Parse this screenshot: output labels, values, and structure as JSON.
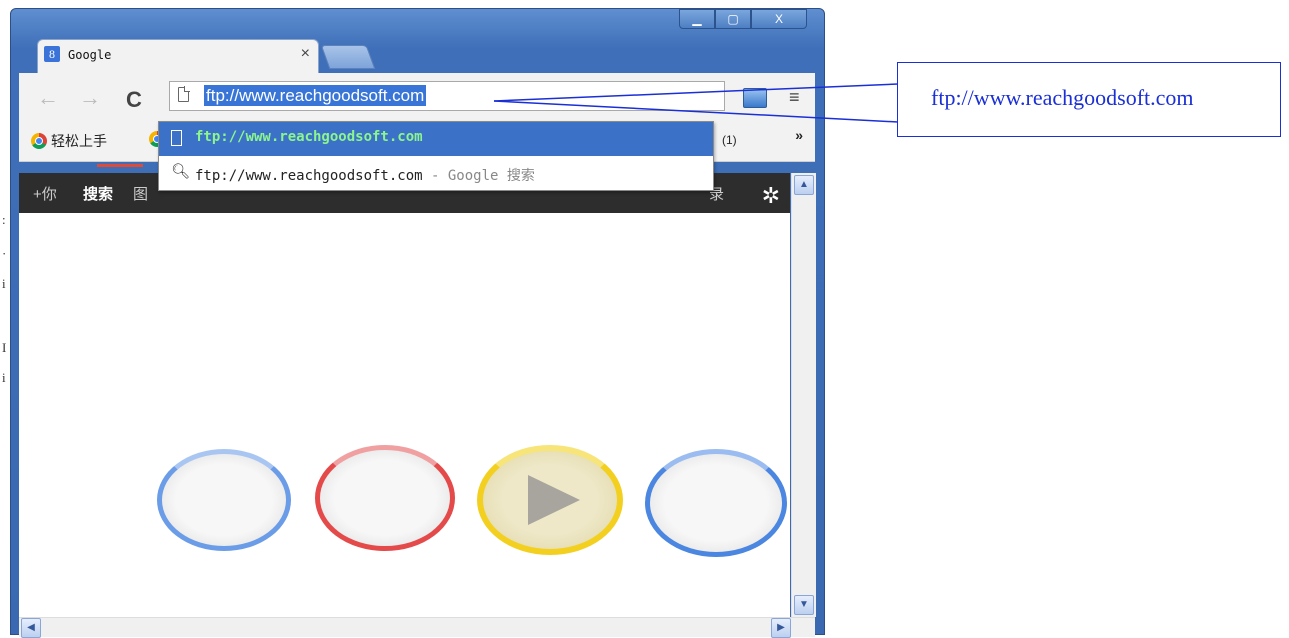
{
  "window": {
    "controls": {
      "minimize": "▁",
      "maximize": "▢",
      "close": "X"
    }
  },
  "tab": {
    "favicon": "8",
    "title": "Google",
    "close": "×"
  },
  "toolbar": {
    "back": "←",
    "forward": "→",
    "reload": "C",
    "url": "ftp://www.reachgoodsoft.com",
    "menu": "≡"
  },
  "bookmarks": {
    "items": [
      {
        "label": "轻松上手"
      }
    ],
    "badge": "(1)",
    "more": "»"
  },
  "gbar": {
    "items": [
      "+你",
      "搜索",
      "图",
      "录"
    ],
    "gear": "✲"
  },
  "autocomplete": {
    "rows": [
      {
        "text": "ftp://www.reachgoodsoft.com"
      },
      {
        "text": "ftp://www.reachgoodsoft.com",
        "suffix": " - Google 搜索"
      }
    ]
  },
  "callout": {
    "text": "ftp://www.reachgoodsoft.com"
  },
  "scroll": {
    "up": "▲",
    "down": "▼",
    "left": "◀",
    "right": "▶"
  },
  "colors": {
    "accent": "#3875d7",
    "callout": "#1a2fd6",
    "suggest_text": "#8cf58c"
  }
}
